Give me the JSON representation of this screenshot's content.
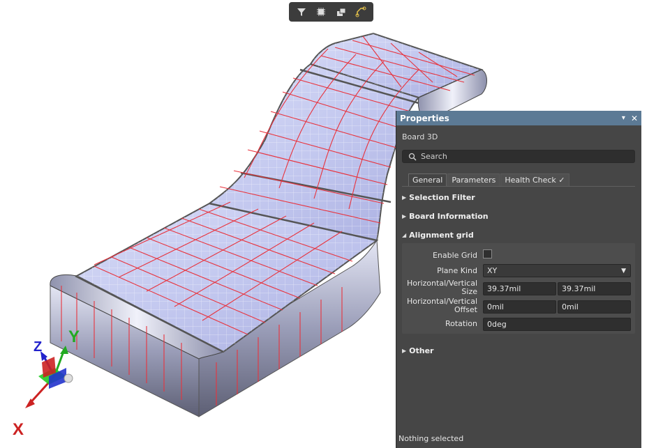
{
  "toolbar": {
    "buttons": [
      {
        "name": "filter-icon"
      },
      {
        "name": "chip-select-icon"
      },
      {
        "name": "layers-icon"
      },
      {
        "name": "route-icon"
      }
    ]
  },
  "axes": {
    "x_label": "X",
    "y_label": "Y",
    "z_label": "Z"
  },
  "panel": {
    "title": "Properties",
    "pin_icon": "pin-dropdown-icon",
    "close_icon": "close-icon",
    "subtitle": "Board 3D",
    "search": {
      "placeholder": "Search",
      "value": ""
    },
    "tabs": [
      {
        "label": "General",
        "active": true
      },
      {
        "label": "Parameters",
        "active": false
      },
      {
        "label": "Health Check",
        "active": false,
        "check": "✓"
      }
    ],
    "sections": {
      "selection_filter": "Selection Filter",
      "board_information": "Board Information",
      "alignment_grid": "Alignment grid",
      "other": "Other"
    },
    "alignment_grid": {
      "enable_grid_label": "Enable Grid",
      "enable_grid_checked": false,
      "plane_kind_label": "Plane Kind",
      "plane_kind_value": "XY",
      "size_label_line1": "Horizontal/Vertical",
      "size_label_line2": "Size",
      "size_h": "39.37mil",
      "size_v": "39.37mil",
      "offset_label_line1": "Horizontal/Vertical",
      "offset_label_line2": "Offset",
      "offset_h": "0mil",
      "offset_v": "0mil",
      "rotation_label": "Rotation",
      "rotation_value": "0deg"
    },
    "status": "Nothing selected"
  },
  "colors": {
    "panel_header": "#5c7a95",
    "panel_bg": "#464646",
    "grid_red": "#e8333d",
    "board_fill": "#c9cdf0",
    "x_axis": "#cc2222",
    "y_axis": "#22aa22",
    "z_axis": "#2222cc"
  }
}
